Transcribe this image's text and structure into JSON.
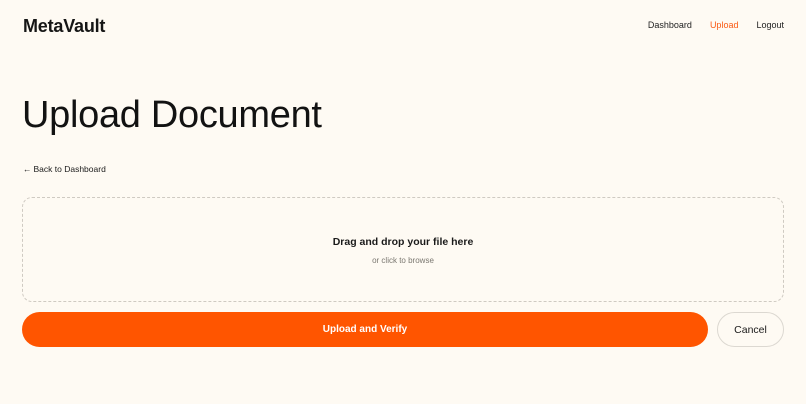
{
  "header": {
    "brand": "MetaVault",
    "nav": [
      {
        "label": "Dashboard",
        "active": false
      },
      {
        "label": "Upload",
        "active": true
      },
      {
        "label": "Logout",
        "active": false
      }
    ]
  },
  "main": {
    "title": "Upload Document",
    "back_link": {
      "arrow": "←",
      "label": "Back to Dashboard"
    },
    "dropzone": {
      "title": "Drag and drop your file here",
      "subtitle": "or click to browse"
    },
    "actions": {
      "upload_label": "Upload and Verify",
      "cancel_label": "Cancel"
    }
  },
  "colors": {
    "background": "#fefaf3",
    "accent": "#ff5500",
    "active_nav": "#fa5a14"
  }
}
